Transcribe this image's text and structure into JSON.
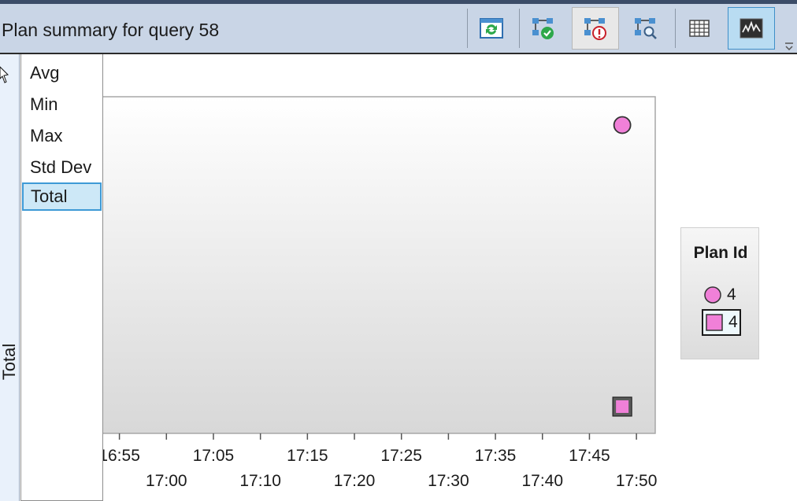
{
  "window": {
    "title": "Plan summary for query 58"
  },
  "toolbar": {
    "buttons": [
      {
        "name": "refresh-icon",
        "state": "normal"
      },
      {
        "name": "force-plan-icon",
        "state": "normal"
      },
      {
        "name": "unforce-plan-icon",
        "state": "pressed"
      },
      {
        "name": "compare-plans-icon",
        "state": "normal"
      },
      {
        "name": "grid-view-icon",
        "state": "normal"
      },
      {
        "name": "chart-view-icon",
        "state": "active"
      }
    ]
  },
  "yaxis": {
    "label": "Total"
  },
  "metric_dropdown": {
    "options": [
      "Avg",
      "Min",
      "Max",
      "Std Dev",
      "Total"
    ],
    "selected": "Total"
  },
  "legend": {
    "title": "Plan Id",
    "entries": [
      {
        "label": "4",
        "marker": "circle",
        "color": "#f080d8"
      },
      {
        "label": "4",
        "marker": "square",
        "color": "#f080d8"
      }
    ]
  },
  "chart_data": {
    "type": "scatter",
    "title": "",
    "xlabel": "",
    "ylabel": "Total",
    "x_ticks_top": [
      "16:55",
      "17:05",
      "17:15",
      "17:25",
      "17:35",
      "17:45"
    ],
    "x_ticks_bottom": [
      "17:00",
      "17:10",
      "17:20",
      "17:30",
      "17:40",
      "17:50"
    ],
    "xlim": [
      "16:49",
      "17:52"
    ],
    "series": [
      {
        "name": "4",
        "marker": "circle",
        "points": [
          {
            "x": "17:50",
            "y": "high"
          }
        ]
      },
      {
        "name": "4",
        "marker": "square",
        "points": [
          {
            "x": "17:50",
            "y": "low"
          }
        ]
      }
    ],
    "grid": false,
    "legend_position": "right",
    "colors": {
      "marker": "#f080d8",
      "plot_bg_top": "#ffffff",
      "plot_bg_bottom": "#d8d8d8"
    }
  }
}
